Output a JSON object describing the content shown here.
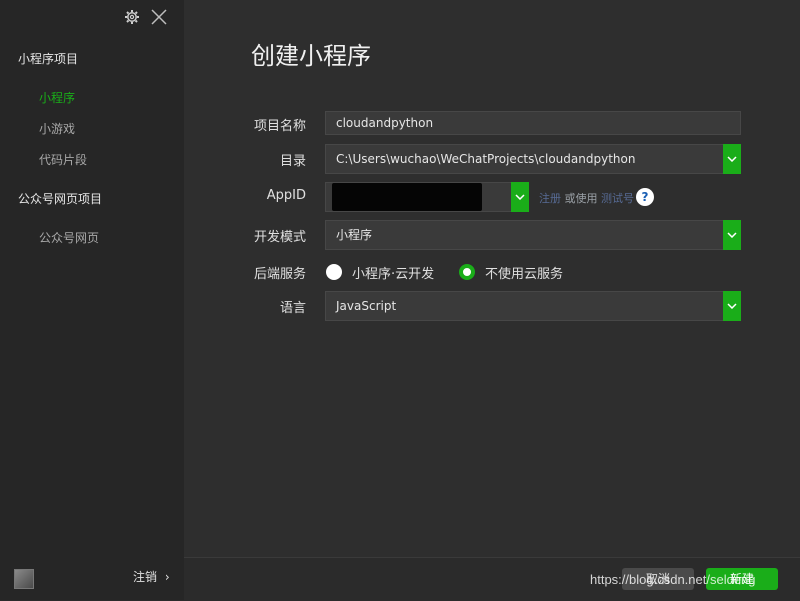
{
  "window": {
    "title": "创建小程序"
  },
  "sidebar": {
    "sections": [
      {
        "title": "小程序项目",
        "items": [
          "小程序",
          "小游戏",
          "代码片段"
        ]
      },
      {
        "title": "公众号网页项目",
        "items": [
          "公众号网页"
        ]
      }
    ],
    "active_item": "小程序",
    "logout_label": "注销",
    "logout_chevron": "›"
  },
  "form": {
    "project_name": {
      "label": "项目名称",
      "value": "cloudandpython"
    },
    "directory": {
      "label": "目录",
      "value": "C:\\Users\\wuchao\\WeChatProjects\\cloudandpython"
    },
    "appid": {
      "label": "AppID",
      "value": "",
      "register_link": "注册",
      "or_use": "或使用",
      "test_link": "测试号",
      "help": "?"
    },
    "dev_mode": {
      "label": "开发模式",
      "value": "小程序"
    },
    "backend": {
      "label": "后端服务",
      "options": [
        {
          "label": "小程序·云开发",
          "checked": false
        },
        {
          "label": "不使用云服务",
          "checked": true
        }
      ]
    },
    "language": {
      "label": "语言",
      "value": "JavaScript"
    }
  },
  "buttons": {
    "cancel": "取消",
    "create": "新建"
  },
  "watermark": "https://blog.csdn.net/seldeng",
  "colors": {
    "accent": "#1aad19",
    "background": "#2e2e2e",
    "sidebar": "#262626",
    "field": "#3a3a3a"
  },
  "icons": [
    "gear-icon",
    "close-icon",
    "chevron-down-icon",
    "help-icon",
    "avatar"
  ]
}
